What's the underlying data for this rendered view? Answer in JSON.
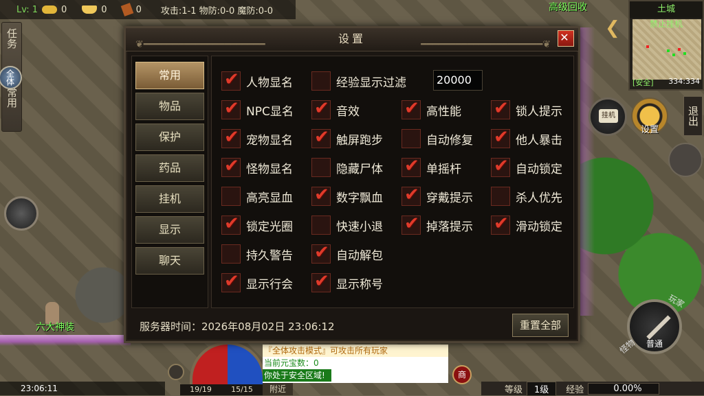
{
  "topbar": {
    "level": "Lv: 1",
    "gold": "0",
    "ingot": "0",
    "token": "0",
    "stats": "攻击:1-1  物防:0-0  魔防:0-0"
  },
  "recycle_label": "高级回收",
  "sidebar": {
    "task": "任务",
    "all": "全体",
    "common": "常用"
  },
  "minimap": {
    "zone": "土城",
    "label": "禁止挂机",
    "safe": "[安全]",
    "coords": "334:334"
  },
  "right": {
    "exit": "退出",
    "settings": "设置",
    "hang": "挂机"
  },
  "attack": {
    "mode": "普通",
    "player_label": "玩家",
    "monster_label": "怪物"
  },
  "npc_name": "六大神装",
  "bottom": {
    "time": "23:06:11",
    "hp": "19/19",
    "mp": "15/15",
    "nearby": "附近",
    "shop": "商",
    "level_label": "等级",
    "level_value": "1级",
    "exp_label": "经验",
    "exp_value": "0.00%"
  },
  "chat": [
    "『全体攻击模式』可攻击所有玩家",
    "当前元宝数：0",
    "你处于安全区域!"
  ],
  "dialog": {
    "title": "设置",
    "close": "✕",
    "tabs": [
      "常用",
      "物品",
      "保护",
      "药品",
      "挂机",
      "显示",
      "聊天"
    ],
    "active_tab": "常用",
    "exp_filter_value": "20000",
    "options": [
      {
        "label": "人物显名",
        "checked": true
      },
      {
        "label": "经验显示过滤",
        "checked": false
      },
      {
        "label": "NPC显名",
        "checked": true
      },
      {
        "label": "音效",
        "checked": true
      },
      {
        "label": "高性能",
        "checked": true
      },
      {
        "label": "锁人提示",
        "checked": true
      },
      {
        "label": "宠物显名",
        "checked": true
      },
      {
        "label": "触屏跑步",
        "checked": true
      },
      {
        "label": "自动修复",
        "checked": false
      },
      {
        "label": "他人暴击",
        "checked": true
      },
      {
        "label": "怪物显名",
        "checked": true
      },
      {
        "label": "隐藏尸体",
        "checked": false
      },
      {
        "label": "单摇杆",
        "checked": true
      },
      {
        "label": "自动锁定",
        "checked": true
      },
      {
        "label": "高亮显血",
        "checked": false
      },
      {
        "label": "数字飘血",
        "checked": true
      },
      {
        "label": "穿戴提示",
        "checked": true
      },
      {
        "label": "杀人优先",
        "checked": false
      },
      {
        "label": "锁定光圈",
        "checked": true
      },
      {
        "label": "快速小退",
        "checked": false
      },
      {
        "label": "掉落提示",
        "checked": true
      },
      {
        "label": "滑动锁定",
        "checked": true
      },
      {
        "label": "持久警告",
        "checked": false
      },
      {
        "label": "自动解包",
        "checked": true
      },
      {
        "label": "显示行会",
        "checked": true
      },
      {
        "label": "显示称号",
        "checked": true
      }
    ],
    "server_time": "服务器时间：2026年08月02日 23:06:12",
    "reset": "重置全部"
  }
}
